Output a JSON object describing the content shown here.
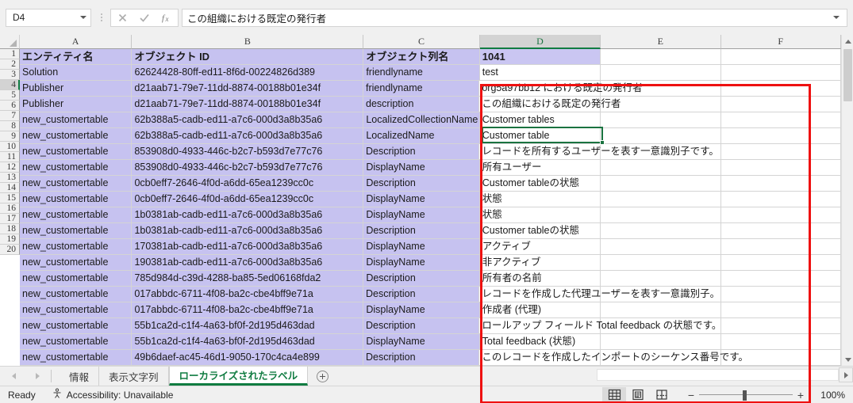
{
  "formula_bar": {
    "name_box_value": "D4",
    "cancel_icon": "x-icon",
    "confirm_icon": "check-icon",
    "function_icon": "fx-icon",
    "formula_value": "この組織における既定の発行者",
    "expand_icon": "chevron-down-icon"
  },
  "grid": {
    "column_headers": [
      "A",
      "B",
      "C",
      "D",
      "E",
      "F"
    ],
    "active_column": "D",
    "active_row": 4,
    "row_numbers": [
      1,
      2,
      3,
      4,
      5,
      6,
      7,
      8,
      9,
      10,
      11,
      12,
      13,
      14,
      15,
      16,
      17,
      18,
      19,
      20
    ],
    "rows": [
      {
        "n": 1,
        "a": "エンティティ名",
        "b": "オブジェクト ID",
        "c": "オブジェクト列名",
        "d": "1041",
        "e": "",
        "f": ""
      },
      {
        "n": 2,
        "a": "Solution",
        "b": "62624428-80ff-ed11-8f6d-00224826d389",
        "c": "friendlyname",
        "d": "test",
        "e": "",
        "f": ""
      },
      {
        "n": 3,
        "a": "Publisher",
        "b": "d21aab71-79e7-11dd-8874-00188b01e34f",
        "c": "friendlyname",
        "d": "org5a97bb12 における既定の発行者",
        "e": "",
        "f": ""
      },
      {
        "n": 4,
        "a": "Publisher",
        "b": "d21aab71-79e7-11dd-8874-00188b01e34f",
        "c": "description",
        "d": "この組織における既定の発行者",
        "e": "",
        "f": ""
      },
      {
        "n": 5,
        "a": "new_customertable",
        "b": "62b388a5-cadb-ed11-a7c6-000d3a8b35a6",
        "c": "LocalizedCollectionName",
        "d": "Customer tables",
        "e": "",
        "f": ""
      },
      {
        "n": 6,
        "a": "new_customertable",
        "b": "62b388a5-cadb-ed11-a7c6-000d3a8b35a6",
        "c": "LocalizedName",
        "d": "Customer table",
        "e": "",
        "f": ""
      },
      {
        "n": 7,
        "a": "new_customertable",
        "b": "853908d0-4933-446c-b2c7-b593d7e77c76",
        "c": "Description",
        "d": "レコードを所有するユーザーを表す一意識別子です。",
        "e": "",
        "f": ""
      },
      {
        "n": 8,
        "a": "new_customertable",
        "b": "853908d0-4933-446c-b2c7-b593d7e77c76",
        "c": "DisplayName",
        "d": "所有ユーザー",
        "e": "",
        "f": ""
      },
      {
        "n": 9,
        "a": "new_customertable",
        "b": "0cb0eff7-2646-4f0d-a6dd-65ea1239cc0c",
        "c": "Description",
        "d": "Customer tableの状態",
        "e": "",
        "f": ""
      },
      {
        "n": 10,
        "a": "new_customertable",
        "b": "0cb0eff7-2646-4f0d-a6dd-65ea1239cc0c",
        "c": "DisplayName",
        "d": "状態",
        "e": "",
        "f": ""
      },
      {
        "n": 11,
        "a": "new_customertable",
        "b": "1b0381ab-cadb-ed11-a7c6-000d3a8b35a6",
        "c": "DisplayName",
        "d": "状態",
        "e": "",
        "f": ""
      },
      {
        "n": 12,
        "a": "new_customertable",
        "b": "1b0381ab-cadb-ed11-a7c6-000d3a8b35a6",
        "c": "Description",
        "d": "Customer tableの状態",
        "e": "",
        "f": ""
      },
      {
        "n": 13,
        "a": "new_customertable",
        "b": "170381ab-cadb-ed11-a7c6-000d3a8b35a6",
        "c": "DisplayName",
        "d": "アクティブ",
        "e": "",
        "f": ""
      },
      {
        "n": 14,
        "a": "new_customertable",
        "b": "190381ab-cadb-ed11-a7c6-000d3a8b35a6",
        "c": "DisplayName",
        "d": "非アクティブ",
        "e": "",
        "f": ""
      },
      {
        "n": 15,
        "a": "new_customertable",
        "b": "785d984d-c39d-4288-ba85-5ed06168fda2",
        "c": "Description",
        "d": "所有者の名前",
        "e": "",
        "f": ""
      },
      {
        "n": 16,
        "a": "new_customertable",
        "b": "017abbdc-6711-4f08-ba2c-cbe4bff9e71a",
        "c": "Description",
        "d": "レコードを作成した代理ユーザーを表す一意識別子。",
        "e": "",
        "f": ""
      },
      {
        "n": 17,
        "a": "new_customertable",
        "b": "017abbdc-6711-4f08-ba2c-cbe4bff9e71a",
        "c": "DisplayName",
        "d": "作成者 (代理)",
        "e": "",
        "f": ""
      },
      {
        "n": 18,
        "a": "new_customertable",
        "b": "55b1ca2d-c1f4-4a63-bf0f-2d195d463dad",
        "c": "Description",
        "d": "ロールアップ フィールド Total feedback の状態です。",
        "e": "",
        "f": ""
      },
      {
        "n": 19,
        "a": "new_customertable",
        "b": "55b1ca2d-c1f4-4a63-bf0f-2d195d463dad",
        "c": "DisplayName",
        "d": "Total feedback (状態)",
        "e": "",
        "f": ""
      },
      {
        "n": 20,
        "a": "new_customertable",
        "b": "49b6daef-ac45-46d1-9050-170c4ca4e899",
        "c": "Description",
        "d": "このレコードを作成したインポートのシーケンス番号です。",
        "e": "",
        "f": ""
      }
    ],
    "selection_highlight_color": "#c6c2f0",
    "selected_cell_border_color": "#1a7340",
    "annotation_box_color": "#ee1111"
  },
  "sheet_tabs": {
    "prev_icon": "chevron-left-icon",
    "next_icon": "chevron-right-icon",
    "tabs": [
      {
        "label": "情報",
        "active": false
      },
      {
        "label": "表示文字列",
        "active": false
      },
      {
        "label": "ローカライズされたラベル",
        "active": true
      }
    ],
    "add_sheet_icon": "plus-circle-icon",
    "active_tab_color": "#107c41"
  },
  "status_bar": {
    "status_text": "Ready",
    "accessibility_icon": "accessibility-icon",
    "accessibility_text": "Accessibility: Unavailable",
    "view_normal_icon": "grid-view-icon",
    "view_pagelayout_icon": "page-layout-icon",
    "view_pagebreak_icon": "page-break-icon",
    "zoom_out_label": "−",
    "zoom_in_label": "+",
    "zoom_level": "100%"
  }
}
